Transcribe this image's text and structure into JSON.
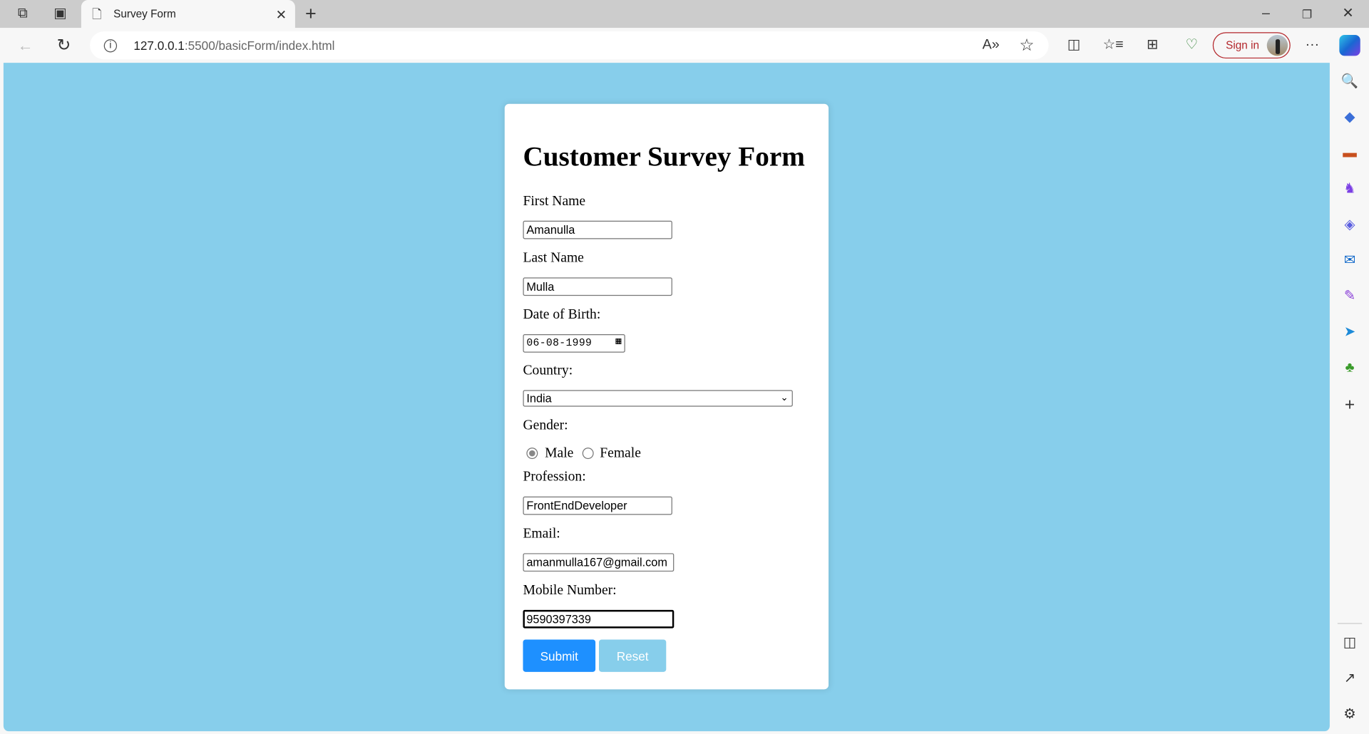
{
  "browser": {
    "tab_title": "Survey Form",
    "url_host": "127.0.0.1",
    "url_rest": ":5500/basicForm/index.html",
    "sign_in_label": "Sign in"
  },
  "form": {
    "title": "Customer Survey Form",
    "first_name_label": "First Name",
    "first_name_value": "Amanulla",
    "last_name_label": "Last Name",
    "last_name_value": "Mulla",
    "dob_label": "Date of Birth:",
    "dob_value": "06-08-1999",
    "country_label": "Country:",
    "country_value": "India",
    "gender_label": "Gender:",
    "gender_options": [
      "Male",
      "Female"
    ],
    "gender_selected": "Male",
    "profession_label": "Profession:",
    "profession_value": "FrontEndDeveloper",
    "email_label": "Email:",
    "email_value": "amanmulla167@gmail.com",
    "mobile_label": "Mobile Number:",
    "mobile_value": "9590397339",
    "submit_label": "Submit",
    "reset_label": "Reset"
  },
  "colors": {
    "page_background": "#87ceeb",
    "submit": "#1e90ff",
    "reset": "#87ceeb",
    "sign_in": "#b3262b"
  }
}
